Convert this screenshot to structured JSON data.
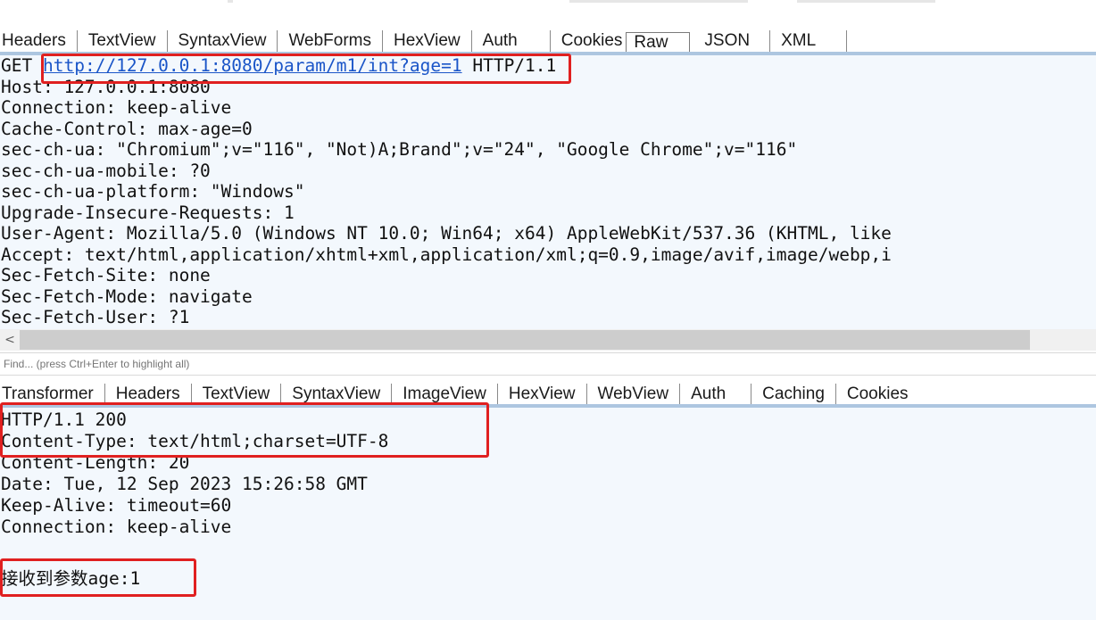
{
  "request": {
    "tabs": [
      "Headers",
      "TextView",
      "SyntaxView",
      "WebForms",
      "HexView",
      "Auth",
      "Cookies",
      "Raw",
      "JSON",
      "XML"
    ],
    "active_tab": "Raw",
    "method": "GET",
    "url": "http://127.0.0.1:8080/param/m1/int?age=1",
    "protocol": "HTTP/1.1",
    "headers": [
      "Host: 127.0.0.1:8080",
      "Connection: keep-alive",
      "Cache-Control: max-age=0",
      "sec-ch-ua: \"Chromium\";v=\"116\", \"Not)A;Brand\";v=\"24\", \"Google Chrome\";v=\"116\"",
      "sec-ch-ua-mobile: ?0",
      "sec-ch-ua-platform: \"Windows\"",
      "Upgrade-Insecure-Requests: 1",
      "User-Agent: Mozilla/5.0 (Windows NT 10.0; Win64; x64) AppleWebKit/537.36 (KHTML, like",
      "Accept: text/html,application/xhtml+xml,application/xml;q=0.9,image/avif,image/webp,i",
      "Sec-Fetch-Site: none",
      "Sec-Fetch-Mode: navigate",
      "Sec-Fetch-User: ?1"
    ],
    "scroll_left_glyph": "<"
  },
  "find": {
    "placeholder": "Find... (press Ctrl+Enter to highlight all)"
  },
  "response": {
    "tabs": [
      "Transformer",
      "Headers",
      "TextView",
      "SyntaxView",
      "ImageView",
      "HexView",
      "WebView",
      "Auth",
      "Caching",
      "Cookies"
    ],
    "lines": [
      "HTTP/1.1 200",
      "Content-Type: text/html;charset=UTF-8",
      "Content-Length: 20",
      "Date: Tue, 12 Sep 2023 15:26:58 GMT",
      "Keep-Alive: timeout=60",
      "Connection: keep-alive",
      "",
      "接收到参数age:1"
    ]
  },
  "colors": {
    "highlight": "#e02020",
    "url": "#1a55c8",
    "pane_bg": "#f3f8fd",
    "tab_border": "#adc6e0"
  }
}
